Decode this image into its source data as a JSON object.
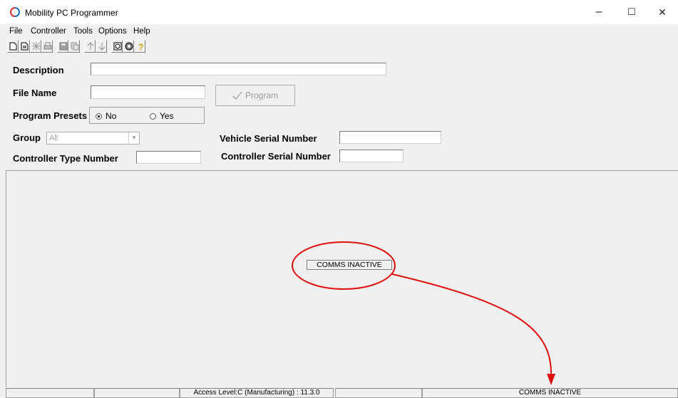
{
  "window": {
    "title": "Mobility PC Programmer",
    "min_glyph": "–",
    "max_glyph": "☐",
    "close_glyph": "✕"
  },
  "menu": [
    "File",
    "Controller",
    "Tools",
    "Options",
    "Help"
  ],
  "toolbar": {
    "icons": [
      "new-file-icon",
      "open-file-icon",
      "erase-icon",
      "print-icon",
      "save-icon",
      "save-as-icon",
      "upload-icon",
      "download-icon",
      "settings-icon",
      "connect-icon",
      "help-icon"
    ]
  },
  "form": {
    "description_label": "Description",
    "description_value": "",
    "filename_label": "File Name",
    "filename_value": "",
    "program_button": "Program",
    "presets_label": "Program Presets",
    "presets_no": "No",
    "presets_yes": "Yes",
    "presets_selected": "No",
    "group_label": "Group",
    "group_value": "All",
    "vehicle_serial_label": "Vehicle Serial Number",
    "vehicle_serial_value": "",
    "controller_type_label": "Controller Type Number",
    "controller_type_value": "",
    "controller_serial_label": "Controller Serial Number",
    "controller_serial_value": ""
  },
  "main": {
    "comms_status": "COMMS INACTIVE"
  },
  "status": {
    "cells": [
      "",
      "",
      "Access Level:C (Manufacturing) : 11.3.0",
      "",
      "COMMS INACTIVE"
    ]
  },
  "annotation": {
    "color": "#e01010"
  }
}
